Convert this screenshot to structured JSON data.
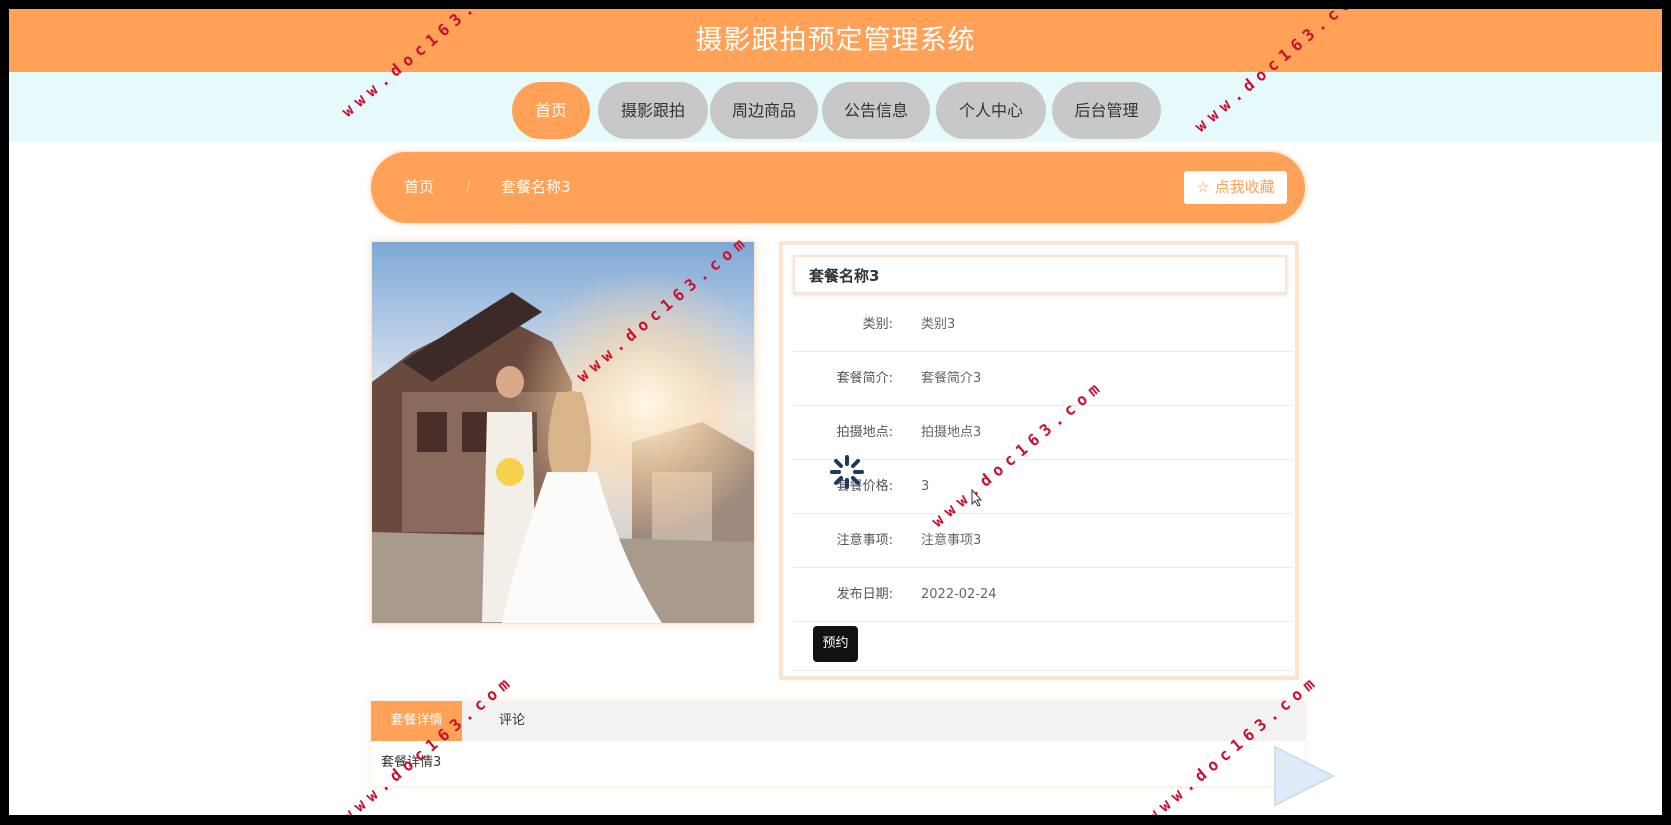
{
  "site": {
    "title": "摄影跟拍预定管理系统"
  },
  "nav": {
    "items": [
      {
        "label": "首页",
        "active": true
      },
      {
        "label": "摄影跟拍",
        "active": false
      },
      {
        "label": "周边商品",
        "active": false
      },
      {
        "label": "公告信息",
        "active": false
      },
      {
        "label": "个人中心",
        "active": false
      },
      {
        "label": "后台管理",
        "active": false
      }
    ]
  },
  "breadcrumb": {
    "home": "首页",
    "separator": "/",
    "current": "套餐名称3",
    "favorite_label": "☆ 点我收藏"
  },
  "detail": {
    "title": "套餐名称3",
    "fields": [
      {
        "label": "类别:",
        "value": "类别3"
      },
      {
        "label": "套餐简介:",
        "value": "套餐简介3"
      },
      {
        "label": "拍摄地点:",
        "value": "拍摄地点3"
      },
      {
        "label": "套餐价格:",
        "value": "3"
      },
      {
        "label": "注意事项:",
        "value": "注意事项3"
      },
      {
        "label": "发布日期:",
        "value": "2022-02-24"
      }
    ],
    "book_label": "预约"
  },
  "tabs": {
    "items": [
      {
        "label": "套餐详情",
        "active": true
      },
      {
        "label": "评论",
        "active": false
      }
    ],
    "content": "套餐详情3"
  },
  "watermark": "www.doc163.com",
  "colors": {
    "accent": "#ffa257",
    "nav_bg": "#e6fafc",
    "inactive": "#c8c8c8",
    "watermark": "#c8102e"
  }
}
